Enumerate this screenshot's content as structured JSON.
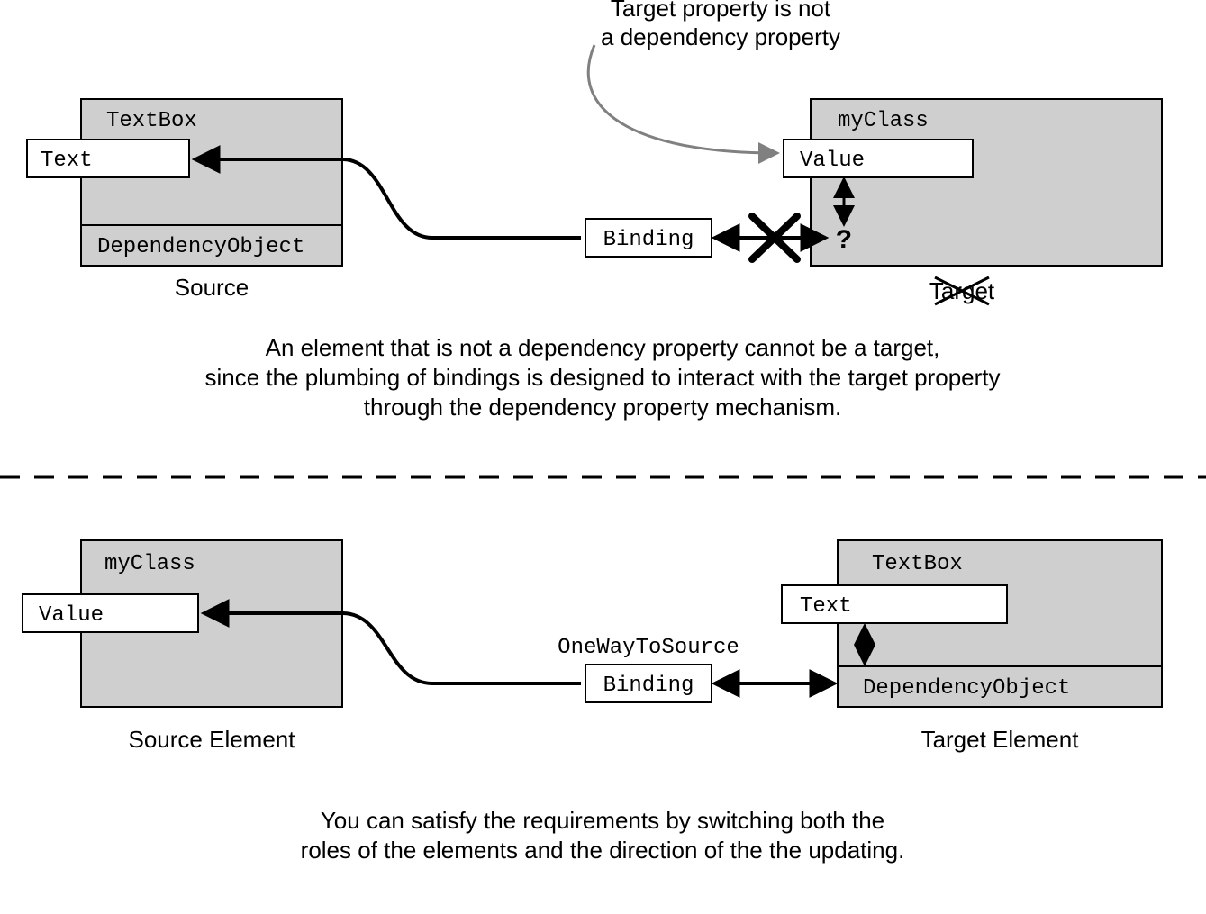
{
  "annotation_top": [
    "Target property is not",
    "a dependency property"
  ],
  "top": {
    "left_box": {
      "title": "TextBox",
      "property": "Text",
      "base": "DependencyObject",
      "caption": "Source"
    },
    "binding": "Binding",
    "right_box": {
      "title": "myClass",
      "property": "Value",
      "q": "?",
      "caption": "Target"
    },
    "explain": [
      "An element that is not a dependency property cannot be a target,",
      "since the plumbing of bindings is designed to interact with the target property",
      "through the dependency property mechanism."
    ]
  },
  "bottom": {
    "left_box": {
      "title": "myClass",
      "property": "Value",
      "caption": "Source Element"
    },
    "binding": "Binding",
    "mode": "OneWayToSource",
    "right_box": {
      "title": "TextBox",
      "property": "Text",
      "base": "DependencyObject",
      "caption": "Target Element"
    },
    "explain": [
      "You can satisfy the requirements by switching both the",
      "roles of the elements and the direction of the the updating."
    ]
  },
  "colors": {
    "fill": "#cfcfcf",
    "stroke": "#000000",
    "white": "#ffffff",
    "grey_stroke": "#808080"
  }
}
